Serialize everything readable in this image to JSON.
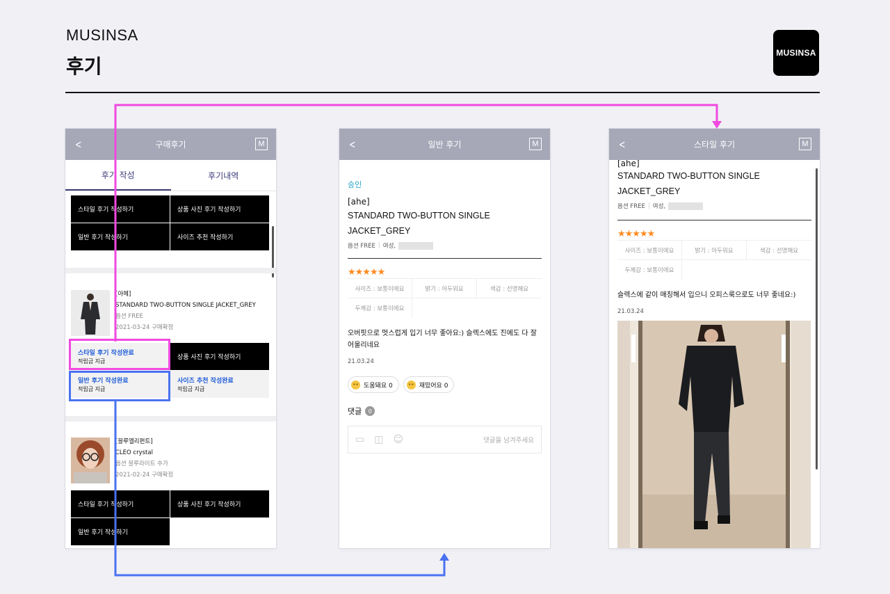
{
  "header": {
    "brand": "MUSINSA",
    "title": "후기",
    "logo_text": "MUSINSA"
  },
  "colors": {
    "appbar": "#a6a8b8",
    "magenta_arrow": "#f049e0",
    "blue_arrow": "#4a72f0",
    "stars": "#ff8a1f",
    "approved": "#1ea0c8"
  },
  "phone1": {
    "appbar_title": "구매후기",
    "m_label": "M",
    "tabs": [
      "후기 작성",
      "후기내역"
    ],
    "top_buttons": [
      "스타일 후기 작성하기",
      "상품 사진 후기 작성하기",
      "일반 후기 작성하기",
      "사이즈 추천 작성하기"
    ],
    "item1": {
      "brand": "[아헤]",
      "name": "STANDARD TWO-BUTTON SINGLE JACKET_GREY",
      "option": "옵션 FREE",
      "date": "2021-03-24 구매확정",
      "style_done": "스타일 후기 작성완료",
      "style_sub": "적립금 지급",
      "photo_btn": "상품 사진 후기 작성하기",
      "general_done": "일반 후기 작성완료",
      "general_sub": "적립금 지급",
      "size_done": "사이즈 추천 작성완료",
      "size_sub": "적립금 지급"
    },
    "item2": {
      "brand": "[블루엘리펀트]",
      "name": "CLEO crystal",
      "option": "옵션 블루라이트 추가",
      "date": "2021-02-24 구매확정",
      "buttons": [
        "스타일 후기 작성하기",
        "상품 사진 후기 작성하기",
        "일반 후기 작성하기"
      ]
    }
  },
  "phone2": {
    "appbar_title": "일반 후기",
    "m_label": "M",
    "status": "승인",
    "brand": "[ahe]",
    "name_line1": "STANDARD TWO-BUTTON SINGLE",
    "name_line2": "JACKET_GREY",
    "option": "옵션 FREE",
    "gender": "여성,",
    "rating": 5,
    "stars": "★★★★★",
    "attributes": [
      "사이즈 : 보통이에요",
      "밝기 : 어두워요",
      "색감 : 선명해요",
      "두께감 : 보통이에요"
    ],
    "review": "오버핏으로 멋스럽게 입기 너무 좋아요:) 슬렉스에도 진에도 다 잘 어울리네요",
    "date": "21.03.24",
    "reactions": [
      {
        "label": "도움돼요 0",
        "icon": "helpful-face-icon"
      },
      {
        "label": "재밌어요 0",
        "icon": "fun-face-icon"
      }
    ],
    "comments_label": "댓글",
    "comments_count": "0",
    "comment_placeholder": "댓글을 남겨주세요"
  },
  "phone3": {
    "appbar_title": "스타일 후기",
    "m_label": "M",
    "brand": "[ahe]",
    "name_line1": "STANDARD TWO-BUTTON SINGLE",
    "name_line2": "JACKET_GREY",
    "option": "옵션 FREE",
    "gender": "여성,",
    "rating": 5,
    "stars": "★★★★★",
    "attributes": [
      "사이즈 : 보통이에요",
      "밝기 : 어두워요",
      "색감 : 선명해요",
      "두께감 : 보통이에요"
    ],
    "review": "슬렉스에 같이 매칭해서 입으니 오피스룩으로도 너무 좋네요:)",
    "date": "21.03.24"
  }
}
